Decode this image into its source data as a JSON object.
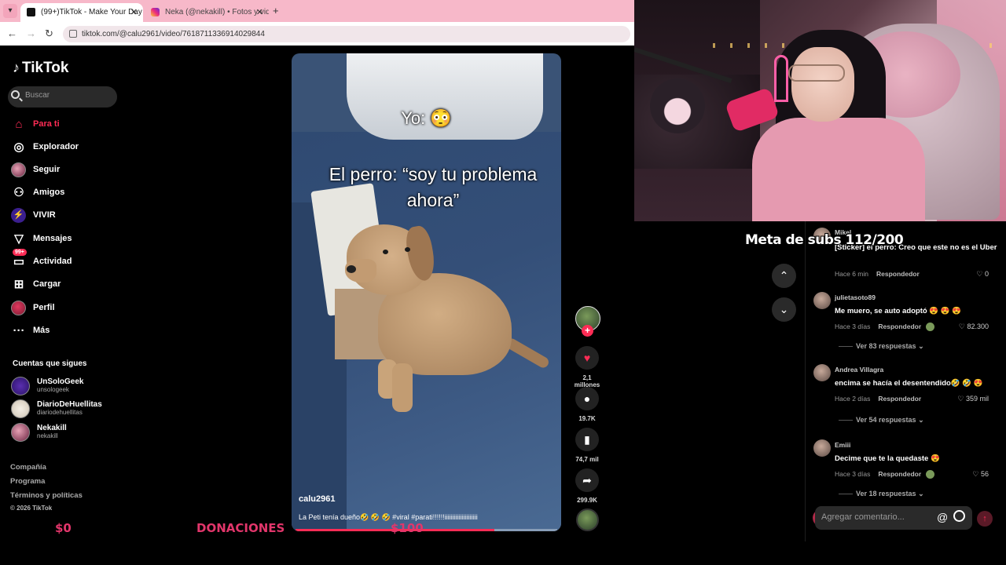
{
  "browser": {
    "tabs": [
      {
        "title": "(99+)TikTok - Make Your Day",
        "active": true
      },
      {
        "title": "Neka (@nekakill) • Fotos y vide",
        "active": false
      }
    ],
    "url": "tiktok.com/@calu2961/video/7618711336914029844"
  },
  "sidebar": {
    "logo": "TikTok",
    "search_placeholder": "Buscar",
    "nav": [
      {
        "label": "Para ti",
        "icon": "home-icon",
        "active": true
      },
      {
        "label": "Explorador",
        "icon": "compass-icon"
      },
      {
        "label": "Seguir",
        "icon": "following-avatar-icon"
      },
      {
        "label": "Amigos",
        "icon": "friends-icon"
      },
      {
        "label": "VIVIR",
        "icon": "live-icon"
      },
      {
        "label": "Mensajes",
        "icon": "send-icon"
      },
      {
        "label": "Actividad",
        "icon": "inbox-icon",
        "badge": "99+"
      },
      {
        "label": "Cargar",
        "icon": "upload-icon"
      },
      {
        "label": "Perfil",
        "icon": "profile-avatar-icon"
      },
      {
        "label": "Más",
        "icon": "more-icon"
      }
    ],
    "following_title": "Cuentas que sigues",
    "following": [
      {
        "name": "UnSoloGeek",
        "handle": "unsologeek"
      },
      {
        "name": "DiarioDeHuellitas",
        "handle": "diariodehuellitas"
      },
      {
        "name": "Nekakill",
        "handle": "nekakill"
      }
    ],
    "footer": [
      "Compañía",
      "Programa",
      "Términos y políticas"
    ],
    "copyright": "© 2026 TikTok"
  },
  "overlay": {
    "left_amount": "$0",
    "donations": "DONACIONES",
    "goal_amount": "$100",
    "subs_goal": "Meta de subs 112/200"
  },
  "video": {
    "caption_top": "Yo: 😳",
    "caption_main": "El perro: “soy tu problema ahora”",
    "username": "calu2961",
    "description": "La Peti tenía dueño🤣 🤣 🤣 #viral #parati!!!!!!iiiiiiiiiiiiiiiiiiiii",
    "progress": 0.76
  },
  "actions": {
    "likes": "2,1 millones",
    "comments": "19.7K",
    "saves": "74,7 mil",
    "shares": "299.9K"
  },
  "comments": [
    {
      "name": "Mikel",
      "text": "[Sticker] el perro: Creo que este no es el Uber",
      "time": "Hace 6 min",
      "reply": "Respondedor",
      "likes": "0"
    },
    {
      "name": "julietasoto89",
      "text": "Me muero, se auto adoptó 😍 😍 😍",
      "time": "Hace 3 días",
      "reply": "Respondedor",
      "likes": "82.300",
      "more": "Ver 83 respuestas"
    },
    {
      "name": "Andrea Villagra",
      "text": "encima se hacía el desentendido🤣 🤣 😍",
      "time": "Hace 2 días",
      "reply": "Respondedor",
      "likes": "359 mil",
      "more": "Ver 54 respuestas"
    },
    {
      "name": "Emiii",
      "text": "Decime que te la quedaste 😍",
      "time": "Hace 3 días",
      "reply": "Respondedor",
      "likes": "56",
      "more": "Ver 18 respuestas"
    }
  ],
  "comment_input": {
    "placeholder": "Agregar comentario..."
  },
  "colors": {
    "accent": "#fe2c55",
    "overlay_pink": "#e2366b",
    "tabbar": "#f7b8c9"
  }
}
